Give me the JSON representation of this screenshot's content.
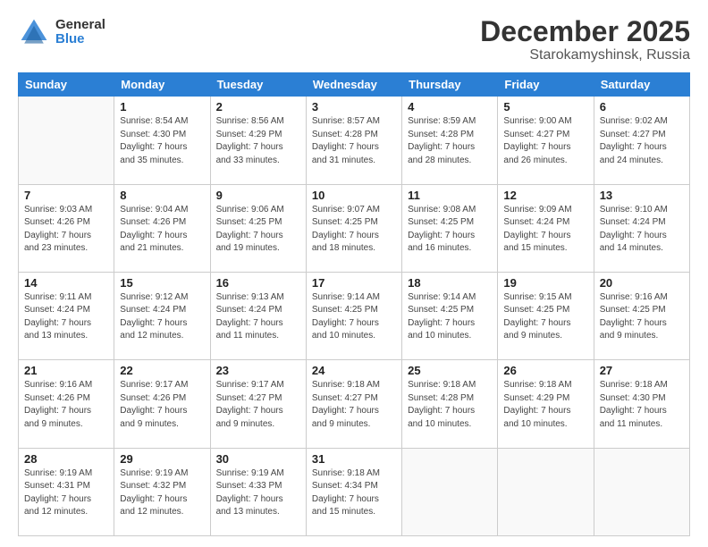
{
  "logo": {
    "general": "General",
    "blue": "Blue"
  },
  "title": "December 2025",
  "location": "Starokamyshinsk, Russia",
  "days_header": [
    "Sunday",
    "Monday",
    "Tuesday",
    "Wednesday",
    "Thursday",
    "Friday",
    "Saturday"
  ],
  "weeks": [
    [
      {
        "day": "",
        "info": ""
      },
      {
        "day": "1",
        "info": "Sunrise: 8:54 AM\nSunset: 4:30 PM\nDaylight: 7 hours\nand 35 minutes."
      },
      {
        "day": "2",
        "info": "Sunrise: 8:56 AM\nSunset: 4:29 PM\nDaylight: 7 hours\nand 33 minutes."
      },
      {
        "day": "3",
        "info": "Sunrise: 8:57 AM\nSunset: 4:28 PM\nDaylight: 7 hours\nand 31 minutes."
      },
      {
        "day": "4",
        "info": "Sunrise: 8:59 AM\nSunset: 4:28 PM\nDaylight: 7 hours\nand 28 minutes."
      },
      {
        "day": "5",
        "info": "Sunrise: 9:00 AM\nSunset: 4:27 PM\nDaylight: 7 hours\nand 26 minutes."
      },
      {
        "day": "6",
        "info": "Sunrise: 9:02 AM\nSunset: 4:27 PM\nDaylight: 7 hours\nand 24 minutes."
      }
    ],
    [
      {
        "day": "7",
        "info": "Sunrise: 9:03 AM\nSunset: 4:26 PM\nDaylight: 7 hours\nand 23 minutes."
      },
      {
        "day": "8",
        "info": "Sunrise: 9:04 AM\nSunset: 4:26 PM\nDaylight: 7 hours\nand 21 minutes."
      },
      {
        "day": "9",
        "info": "Sunrise: 9:06 AM\nSunset: 4:25 PM\nDaylight: 7 hours\nand 19 minutes."
      },
      {
        "day": "10",
        "info": "Sunrise: 9:07 AM\nSunset: 4:25 PM\nDaylight: 7 hours\nand 18 minutes."
      },
      {
        "day": "11",
        "info": "Sunrise: 9:08 AM\nSunset: 4:25 PM\nDaylight: 7 hours\nand 16 minutes."
      },
      {
        "day": "12",
        "info": "Sunrise: 9:09 AM\nSunset: 4:24 PM\nDaylight: 7 hours\nand 15 minutes."
      },
      {
        "day": "13",
        "info": "Sunrise: 9:10 AM\nSunset: 4:24 PM\nDaylight: 7 hours\nand 14 minutes."
      }
    ],
    [
      {
        "day": "14",
        "info": "Sunrise: 9:11 AM\nSunset: 4:24 PM\nDaylight: 7 hours\nand 13 minutes."
      },
      {
        "day": "15",
        "info": "Sunrise: 9:12 AM\nSunset: 4:24 PM\nDaylight: 7 hours\nand 12 minutes."
      },
      {
        "day": "16",
        "info": "Sunrise: 9:13 AM\nSunset: 4:24 PM\nDaylight: 7 hours\nand 11 minutes."
      },
      {
        "day": "17",
        "info": "Sunrise: 9:14 AM\nSunset: 4:25 PM\nDaylight: 7 hours\nand 10 minutes."
      },
      {
        "day": "18",
        "info": "Sunrise: 9:14 AM\nSunset: 4:25 PM\nDaylight: 7 hours\nand 10 minutes."
      },
      {
        "day": "19",
        "info": "Sunrise: 9:15 AM\nSunset: 4:25 PM\nDaylight: 7 hours\nand 9 minutes."
      },
      {
        "day": "20",
        "info": "Sunrise: 9:16 AM\nSunset: 4:25 PM\nDaylight: 7 hours\nand 9 minutes."
      }
    ],
    [
      {
        "day": "21",
        "info": "Sunrise: 9:16 AM\nSunset: 4:26 PM\nDaylight: 7 hours\nand 9 minutes."
      },
      {
        "day": "22",
        "info": "Sunrise: 9:17 AM\nSunset: 4:26 PM\nDaylight: 7 hours\nand 9 minutes."
      },
      {
        "day": "23",
        "info": "Sunrise: 9:17 AM\nSunset: 4:27 PM\nDaylight: 7 hours\nand 9 minutes."
      },
      {
        "day": "24",
        "info": "Sunrise: 9:18 AM\nSunset: 4:27 PM\nDaylight: 7 hours\nand 9 minutes."
      },
      {
        "day": "25",
        "info": "Sunrise: 9:18 AM\nSunset: 4:28 PM\nDaylight: 7 hours\nand 10 minutes."
      },
      {
        "day": "26",
        "info": "Sunrise: 9:18 AM\nSunset: 4:29 PM\nDaylight: 7 hours\nand 10 minutes."
      },
      {
        "day": "27",
        "info": "Sunrise: 9:18 AM\nSunset: 4:30 PM\nDaylight: 7 hours\nand 11 minutes."
      }
    ],
    [
      {
        "day": "28",
        "info": "Sunrise: 9:19 AM\nSunset: 4:31 PM\nDaylight: 7 hours\nand 12 minutes."
      },
      {
        "day": "29",
        "info": "Sunrise: 9:19 AM\nSunset: 4:32 PM\nDaylight: 7 hours\nand 12 minutes."
      },
      {
        "day": "30",
        "info": "Sunrise: 9:19 AM\nSunset: 4:33 PM\nDaylight: 7 hours\nand 13 minutes."
      },
      {
        "day": "31",
        "info": "Sunrise: 9:18 AM\nSunset: 4:34 PM\nDaylight: 7 hours\nand 15 minutes."
      },
      {
        "day": "",
        "info": ""
      },
      {
        "day": "",
        "info": ""
      },
      {
        "day": "",
        "info": ""
      }
    ]
  ]
}
